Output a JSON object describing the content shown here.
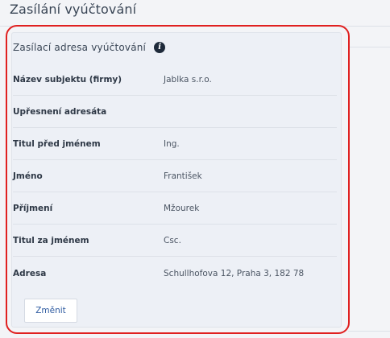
{
  "page": {
    "title": "Zasílání vyúčtování"
  },
  "section": {
    "title": "Zasílací adresa vyúčtování",
    "info_icon": "info-icon"
  },
  "rows": [
    {
      "label": "Název subjektu (firmy)",
      "value": "Jablka s.r.o."
    },
    {
      "label": "Upřesnení adresáta",
      "value": ""
    },
    {
      "label": "Titul před jménem",
      "value": "Ing."
    },
    {
      "label": "Jméno",
      "value": "František"
    },
    {
      "label": "Příjmení",
      "value": "Mžourek"
    },
    {
      "label": "Titul za jménem",
      "value": "Csc."
    },
    {
      "label": "Adresa",
      "value": "Schullhofova 12, Praha 3, 182 78"
    }
  ],
  "actions": {
    "change_label": "Změnit"
  },
  "colors": {
    "highlight_border": "#e02020",
    "link_text": "#2d5aa0",
    "panel_background": "#edf0f6"
  }
}
